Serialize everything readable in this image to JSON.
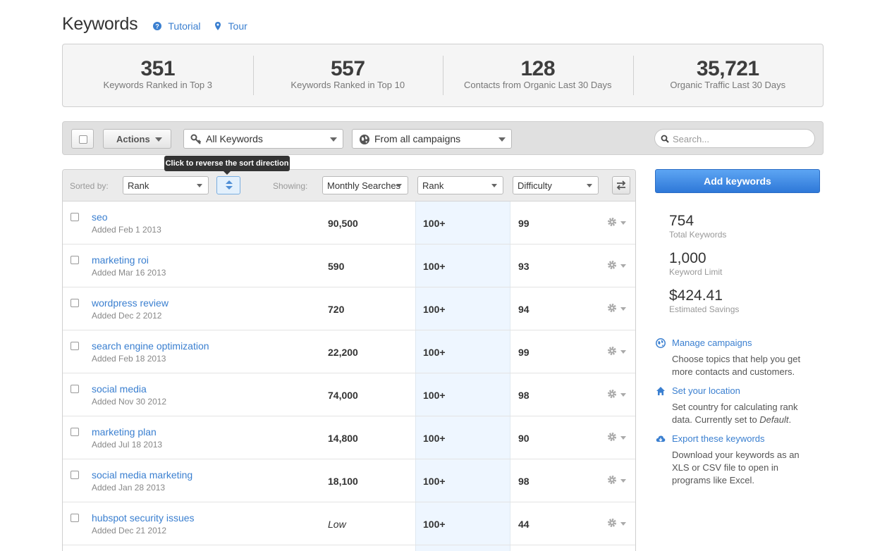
{
  "header": {
    "title": "Keywords",
    "tutorial_label": "Tutorial",
    "tour_label": "Tour"
  },
  "stats": [
    {
      "value": "351",
      "label": "Keywords Ranked in Top 3"
    },
    {
      "value": "557",
      "label": "Keywords Ranked in Top 10"
    },
    {
      "value": "128",
      "label": "Contacts from Organic Last 30 Days"
    },
    {
      "value": "35,721",
      "label": "Organic Traffic Last 30 Days"
    }
  ],
  "toolbar": {
    "actions_label": "Actions",
    "keyword_filter": "All Keywords",
    "campaign_filter": "From all campaigns",
    "search_placeholder": "Search..."
  },
  "tooltip": "Click to reverse the sort direction",
  "table_header": {
    "sorted_by_label": "Sorted by:",
    "sorted_by_value": "Rank",
    "showing_label": "Showing:",
    "col1": "Monthly Searches",
    "col2": "Rank",
    "col3": "Difficulty"
  },
  "rows": [
    {
      "keyword": "seo",
      "added": "Added Feb 1 2013",
      "searches": "90,500",
      "rank": "100+",
      "difficulty": "99"
    },
    {
      "keyword": "marketing roi",
      "added": "Added Mar 16 2013",
      "searches": "590",
      "rank": "100+",
      "difficulty": "93"
    },
    {
      "keyword": "wordpress review",
      "added": "Added Dec 2 2012",
      "searches": "720",
      "rank": "100+",
      "difficulty": "94"
    },
    {
      "keyword": "search engine optimization",
      "added": "Added Feb 18 2013",
      "searches": "22,200",
      "rank": "100+",
      "difficulty": "99"
    },
    {
      "keyword": "social media",
      "added": "Added Nov 30 2012",
      "searches": "74,000",
      "rank": "100+",
      "difficulty": "98"
    },
    {
      "keyword": "marketing plan",
      "added": "Added Jul 18 2013",
      "searches": "14,800",
      "rank": "100+",
      "difficulty": "90"
    },
    {
      "keyword": "social media marketing",
      "added": "Added Jan 28 2013",
      "searches": "18,100",
      "rank": "100+",
      "difficulty": "98"
    },
    {
      "keyword": "hubspot security issues",
      "added": "Added Dec 21 2012",
      "searches": "Low",
      "rank": "100+",
      "difficulty": "44"
    }
  ],
  "sidebar": {
    "add_button": "Add keywords",
    "total_keywords": {
      "value": "754",
      "label": "Total Keywords"
    },
    "keyword_limit": {
      "value": "1,000",
      "label": "Keyword Limit"
    },
    "estimated_savings": {
      "value": "$424.41",
      "label": "Estimated Savings"
    },
    "manage": {
      "title": "Manage campaigns",
      "desc": "Choose topics that help you get more contacts and customers."
    },
    "location": {
      "title": "Set your location",
      "desc_prefix": "Set country for calculating rank data. Currently set to ",
      "desc_value": "Default",
      "desc_suffix": "."
    },
    "export": {
      "title": "Export these keywords",
      "desc": "Download your keywords as an XLS or CSV file to open in programs like Excel."
    }
  },
  "colors": {
    "link": "#3a7fd0",
    "primary_button": "#3b86e0",
    "rank_highlight": "#eef6ff"
  }
}
